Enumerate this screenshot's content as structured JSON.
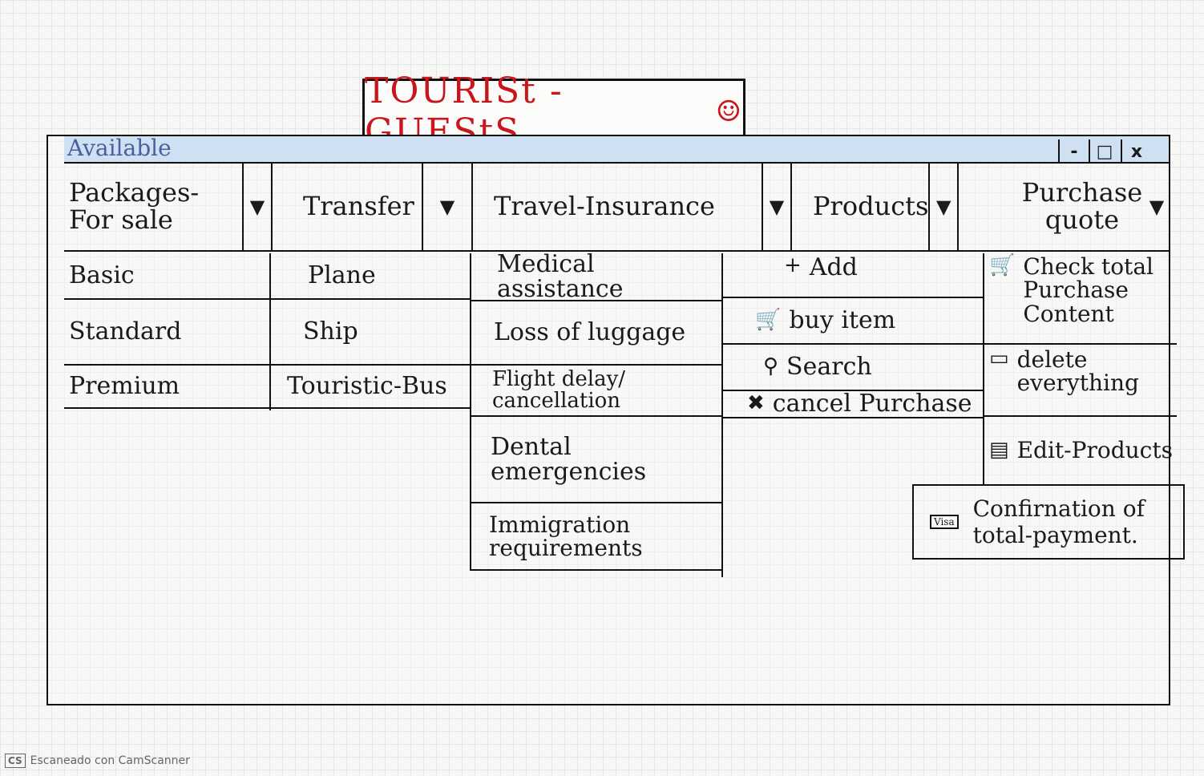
{
  "header": {
    "title": "TOURISt - GUEStS",
    "smiley": "☺"
  },
  "window": {
    "label": "Available",
    "buttons": {
      "minimize": "-",
      "maximize": "□",
      "close": "x"
    }
  },
  "tabs": [
    {
      "label": "Packages-For sale",
      "arrow": "▼"
    },
    {
      "label": "Transfer",
      "arrow": "▼"
    },
    {
      "label": "Travel-Insurance",
      "arrow": "▼"
    },
    {
      "label": "Products",
      "arrow": "▼"
    },
    {
      "label": "Purchase quote",
      "arrow": "▼"
    }
  ],
  "packages": {
    "items": [
      "Basic",
      "Standard",
      "Premium"
    ]
  },
  "transfer": {
    "items": [
      "Plane",
      "Ship",
      "Touristic-Bus"
    ]
  },
  "insurance": {
    "items": [
      "Medical assistance",
      "Loss of luggage",
      "Flight delay/ cancellation",
      "Dental emergencies",
      "Immigration requirements"
    ]
  },
  "products": {
    "items": [
      {
        "icon": "+",
        "icon_name": "plus-icon",
        "label": "Add"
      },
      {
        "icon": "🛒",
        "icon_name": "cart-icon",
        "label": "buy item"
      },
      {
        "icon": "⚲",
        "icon_name": "search-icon",
        "label": "Search"
      },
      {
        "icon": "✖",
        "icon_name": "cancel-icon",
        "label": "cancel Purchase"
      }
    ]
  },
  "purchase": {
    "items": [
      {
        "icon": "🛒",
        "icon_name": "cart-icon",
        "label": "Check total Purchase Content"
      },
      {
        "icon": "▭",
        "icon_name": "trash-icon",
        "label": "delete everything"
      },
      {
        "icon": "▤",
        "icon_name": "edit-icon",
        "label": "Edit-Products"
      }
    ],
    "confirmation": {
      "icon": "Visa",
      "icon_name": "card-icon",
      "label": "Confirnation of total-payment."
    }
  },
  "footer": {
    "badge": "CS",
    "text": "Escaneado con CamScanner"
  }
}
